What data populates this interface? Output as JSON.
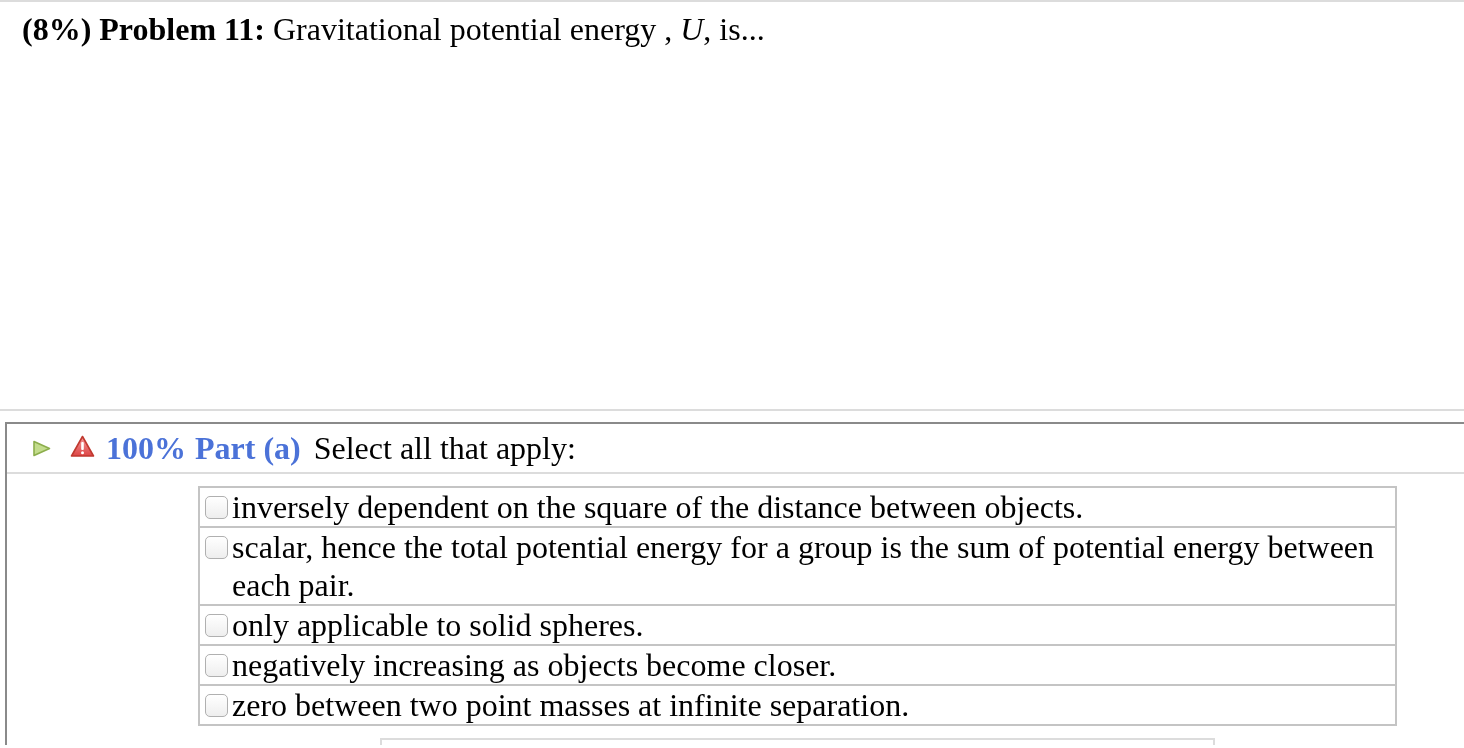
{
  "problem": {
    "statement": "**(8%) Problem 11:** Gravitational potential energy , *U*, is..."
  },
  "part": {
    "score": "100%",
    "label": "Part (a)",
    "instruction": "Select all that apply:"
  },
  "options": [
    {
      "text": "inversely dependent on the square of the distance between objects.",
      "checked": false
    },
    {
      "text": "scalar, hence the total potential energy for a group is the sum of potential energy between each pair.",
      "checked": false
    },
    {
      "text": "only applicable to solid spheres.",
      "checked": false
    },
    {
      "text": "negatively increasing as objects become closer.",
      "checked": false
    },
    {
      "text": "zero between two point masses at infinite separation.",
      "checked": false
    }
  ]
}
